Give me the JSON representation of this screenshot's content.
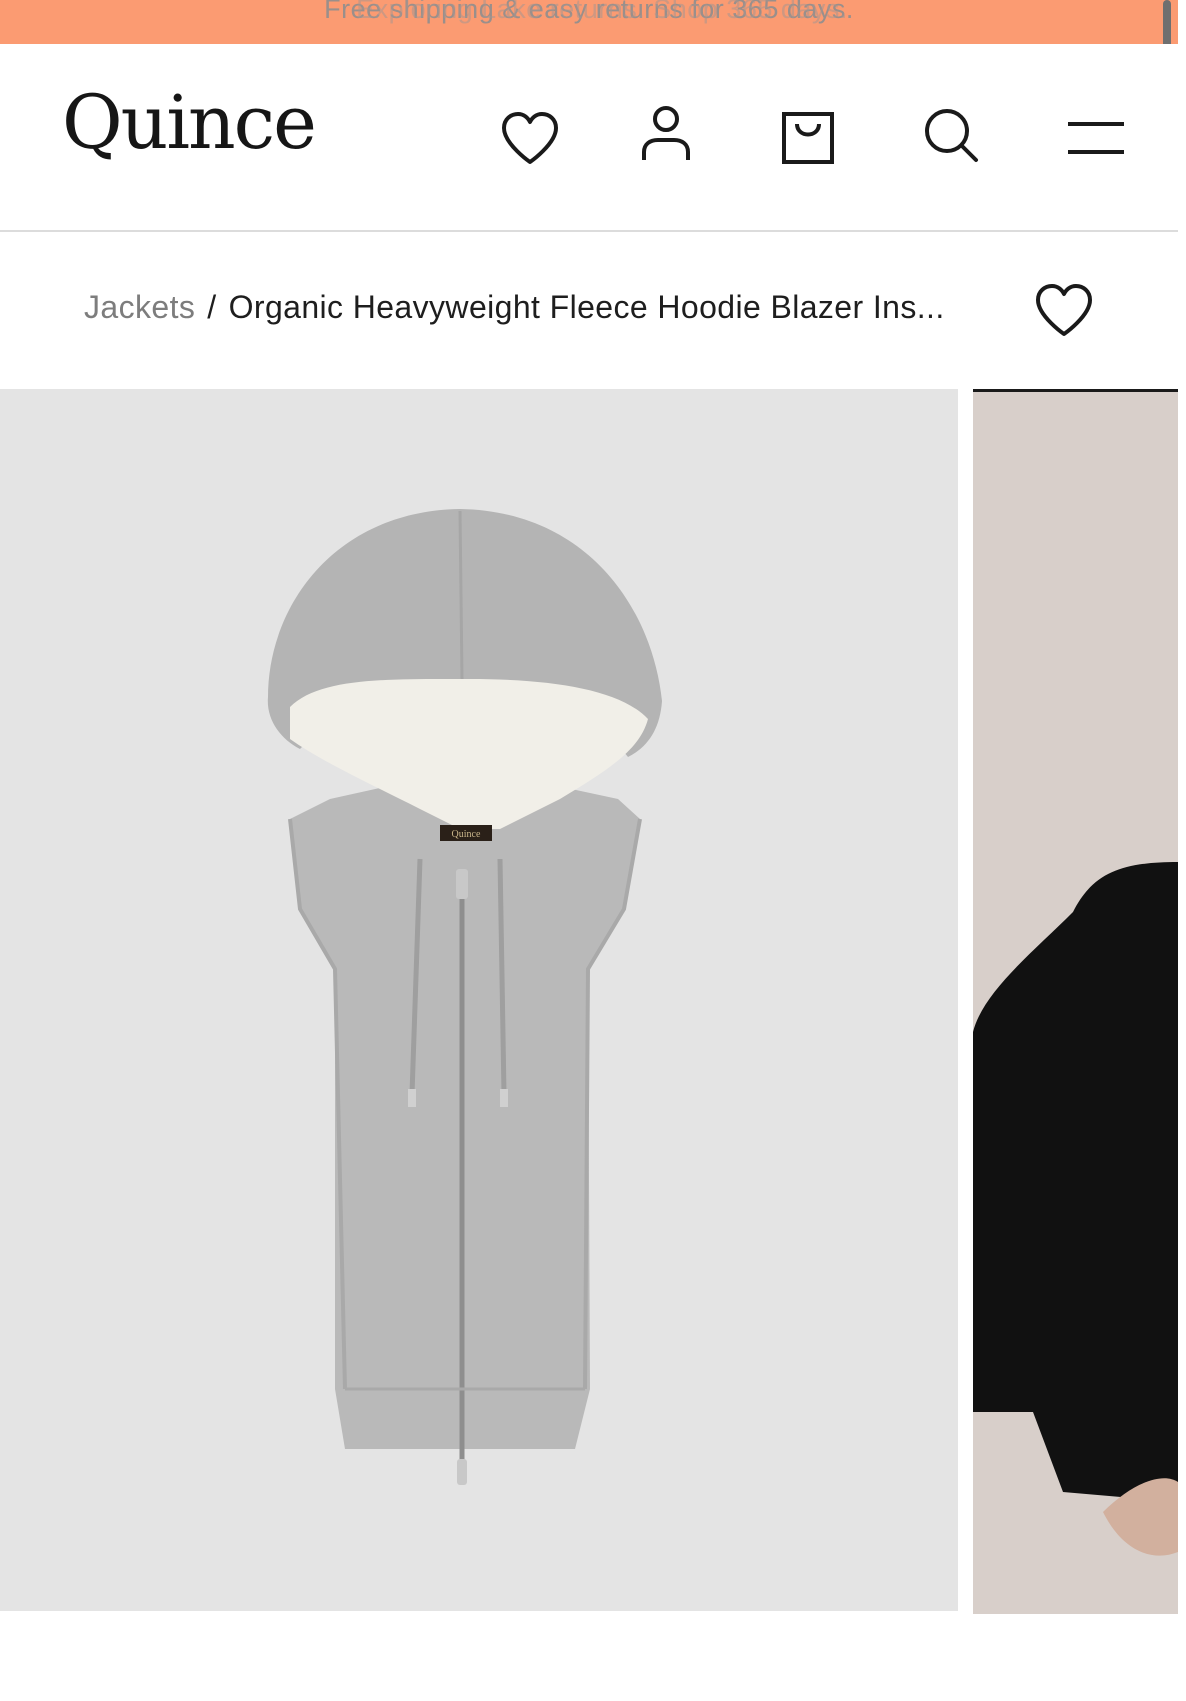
{
  "promo_banner": {
    "text": "Free shipping & easy returns for 365 days.",
    "secondary_text": "Exploring Lake returns. Shop 365 days."
  },
  "header": {
    "logo": "Quince",
    "icons": [
      "heart-icon",
      "account-icon",
      "bag-icon",
      "search-icon",
      "menu-icon"
    ]
  },
  "breadcrumb": {
    "parent": "Jackets",
    "separator": "/",
    "current": "Organic Heavyweight Fleece Hoodie Blazer Ins..."
  },
  "product_images": {
    "primary": {
      "label": "Quince",
      "description": "gray-hoodie-insert"
    },
    "secondary": {
      "description": "model-black-blazer"
    }
  },
  "colors": {
    "banner": "#fb9b72",
    "image_bg": "#e4e4e4",
    "hoodie": "#b9b9b9",
    "lining": "#f1efe8"
  }
}
